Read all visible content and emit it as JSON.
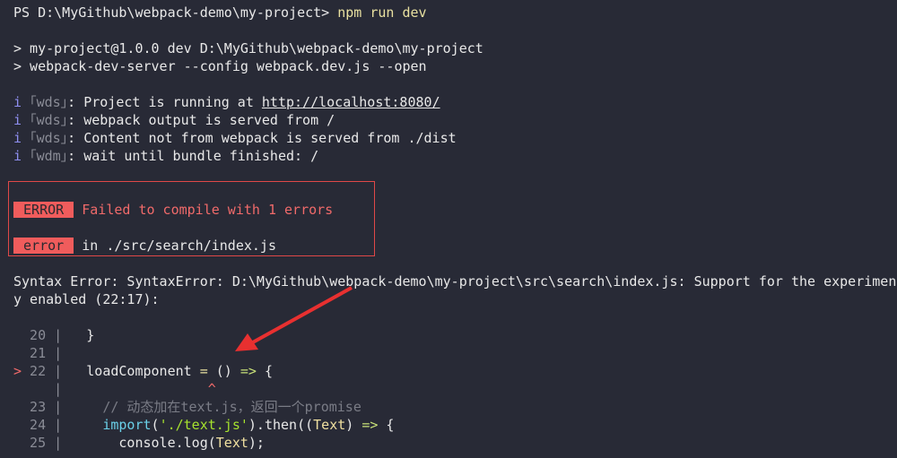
{
  "terminal": {
    "lines": [
      [
        {
          "t": "PS D:\\MyGithub\\webpack-demo\\my-project> ",
          "c": "fg"
        },
        {
          "t": "npm run dev",
          "c": "cmd"
        }
      ],
      [],
      [
        {
          "t": "> my-project@1.0.0 dev D:\\MyGithub\\webpack-demo\\my-project",
          "c": "fg"
        }
      ],
      [
        {
          "t": "> webpack-dev-server --config webpack.dev.js --open",
          "c": "fg"
        }
      ],
      [],
      [
        {
          "t": "i ",
          "c": "info"
        },
        {
          "t": "｢wds｣",
          "c": "dim"
        },
        {
          "t": ": Project is running at ",
          "c": "fg"
        },
        {
          "t": "http://localhost:8080/",
          "c": "fg link"
        }
      ],
      [
        {
          "t": "i ",
          "c": "info"
        },
        {
          "t": "｢wds｣",
          "c": "dim"
        },
        {
          "t": ": webpack output is served from /",
          "c": "fg"
        }
      ],
      [
        {
          "t": "i ",
          "c": "info"
        },
        {
          "t": "｢wds｣",
          "c": "dim"
        },
        {
          "t": ": Content not from webpack is served from ./dist",
          "c": "fg"
        }
      ],
      [
        {
          "t": "i ",
          "c": "info"
        },
        {
          "t": "｢wdm｣",
          "c": "dim"
        },
        {
          "t": ": wait until bundle finished: /",
          "c": "fg"
        }
      ],
      [],
      [],
      [
        {
          "t": " ERROR ",
          "c": "badge"
        },
        {
          "t": " Failed to compile with 1 errors",
          "c": "err"
        }
      ],
      [],
      [
        {
          "t": " error ",
          "c": "badge"
        },
        {
          "t": " in ./src/search/index.js",
          "c": "fg"
        }
      ],
      [],
      [
        {
          "t": "Syntax Error: SyntaxError: D:\\MyGithub\\webpack-demo\\my-project\\src\\search\\index.js: Support for the experiment",
          "c": "fg"
        }
      ],
      [
        {
          "t": "y enabled (22:17):",
          "c": "fg"
        }
      ],
      [],
      [
        {
          "t": "  20 | ",
          "c": "ln"
        },
        {
          "t": "  }",
          "c": "fg"
        }
      ],
      [
        {
          "t": "  21 | ",
          "c": "ln"
        }
      ],
      [
        {
          "t": ">",
          "c": "mark"
        },
        {
          "t": " 22 | ",
          "c": "ln"
        },
        {
          "t": "  loadComponent ",
          "c": "fg"
        },
        {
          "t": "=",
          "c": "op"
        },
        {
          "t": " () ",
          "c": "fg"
        },
        {
          "t": "=>",
          "c": "arrow-op"
        },
        {
          "t": " {",
          "c": "fg"
        }
      ],
      [
        {
          "t": "     | ",
          "c": "ln"
        },
        {
          "t": "                 ^",
          "c": "mark"
        }
      ],
      [
        {
          "t": "  23 | ",
          "c": "ln"
        },
        {
          "t": "    // 动态加在text.js，返回一个promise",
          "c": "cmt"
        }
      ],
      [
        {
          "t": "  24 | ",
          "c": "ln"
        },
        {
          "t": "    ",
          "c": "fg"
        },
        {
          "t": "import",
          "c": "kw"
        },
        {
          "t": "(",
          "c": "fg"
        },
        {
          "t": "'./text.js'",
          "c": "str"
        },
        {
          "t": ").then((",
          "c": "fg"
        },
        {
          "t": "Text",
          "c": "param"
        },
        {
          "t": ") ",
          "c": "fg"
        },
        {
          "t": "=>",
          "c": "arrow-op"
        },
        {
          "t": " {",
          "c": "fg"
        }
      ],
      [
        {
          "t": "  25 | ",
          "c": "ln"
        },
        {
          "t": "      console.log(",
          "c": "fg"
        },
        {
          "t": "Text",
          "c": "param"
        },
        {
          "t": ");",
          "c": "fg"
        }
      ]
    ]
  },
  "annotation": {
    "color": "#e83030"
  }
}
